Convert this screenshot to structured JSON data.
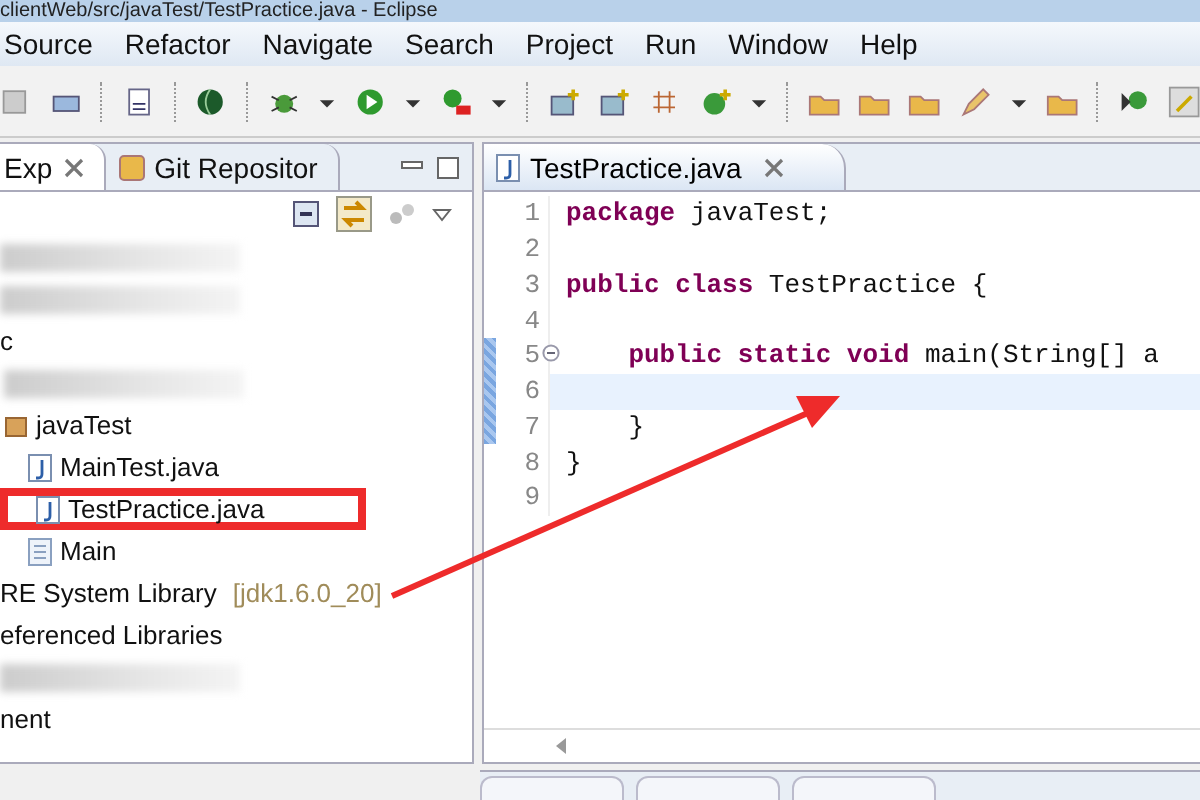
{
  "window": {
    "title": "clientWeb/src/javaTest/TestPractice.java - Eclipse"
  },
  "menu": [
    "Source",
    "Refactor",
    "Navigate",
    "Search",
    "Project",
    "Run",
    "Window",
    "Help"
  ],
  "left_panel": {
    "tabs": [
      {
        "label": "Exp",
        "selected": true,
        "closable": true
      },
      {
        "label": "Git Repositor",
        "selected": false,
        "closable": false
      }
    ],
    "tree": [
      {
        "kind": "blurred"
      },
      {
        "kind": "blurred"
      },
      {
        "kind": "folder",
        "text": "c",
        "children": [
          {
            "kind": "blurred"
          },
          {
            "kind": "package",
            "text": "javaTest",
            "children": [
              {
                "kind": "java",
                "text": "MainTest.java",
                "boxed": false
              },
              {
                "kind": "java",
                "text": "TestPractice.java",
                "boxed": true
              },
              {
                "kind": "file",
                "text": "Main",
                "boxed": false
              }
            ]
          }
        ]
      },
      {
        "kind": "library",
        "text": "RE System Library",
        "decoration": "[jdk1.6.0_20]"
      },
      {
        "kind": "folder",
        "text": "eferenced Libraries"
      },
      {
        "kind": "blurred"
      },
      {
        "kind": "folder",
        "text": "nent"
      }
    ]
  },
  "editor": {
    "tab": {
      "label": "TestPractice.java",
      "selected": true
    },
    "lines": [
      {
        "number": "1",
        "current": false,
        "folded": false,
        "tokens": [
          {
            "text": "package",
            "kind": "keyword"
          },
          {
            "text": " javaTest;",
            "kind": "plain"
          }
        ]
      },
      {
        "number": "2",
        "current": false,
        "folded": false
      },
      {
        "number": "3",
        "current": false,
        "folded": false,
        "tokens": [
          {
            "text": "public class",
            "kind": "keyword"
          },
          {
            "text": " TestPractice {",
            "kind": "plain"
          }
        ]
      },
      {
        "number": "4",
        "current": false,
        "folded": false
      },
      {
        "number": "5",
        "current": false,
        "folded": true,
        "tokens": [
          {
            "text": "    public static void",
            "kind": "keyword"
          },
          {
            "text": " main(String[] a",
            "kind": "plain"
          }
        ]
      },
      {
        "number": "6",
        "current": true,
        "folded": false
      },
      {
        "number": "7",
        "current": false,
        "folded": false,
        "tokens": [
          {
            "text": "    }",
            "kind": "plain"
          }
        ]
      },
      {
        "number": "8",
        "current": false,
        "folded": false,
        "tokens": [
          {
            "text": "}",
            "kind": "plain"
          }
        ]
      },
      {
        "number": "9",
        "current": false,
        "folded": false
      }
    ]
  }
}
